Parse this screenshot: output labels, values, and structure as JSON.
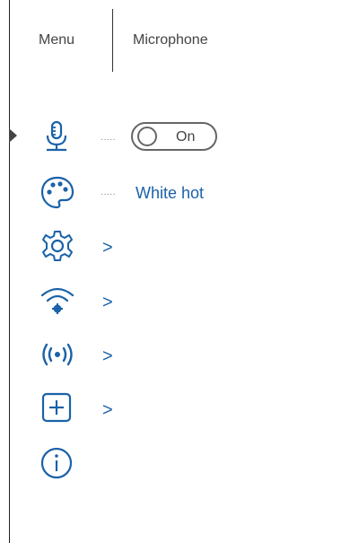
{
  "header": {
    "menu_label": "Menu",
    "title": "Microphone"
  },
  "menu": {
    "items": [
      {
        "icon": "microphone-icon",
        "trail": "dots",
        "control": "toggle",
        "toggle_label": "On",
        "toggle_state": "on"
      },
      {
        "icon": "palette-icon",
        "trail": "dots",
        "value": "White hot"
      },
      {
        "icon": "settings-gear-icon",
        "trail": ">"
      },
      {
        "icon": "wifi-settings-icon",
        "trail": ">"
      },
      {
        "icon": "broadcast-icon",
        "trail": ">"
      },
      {
        "icon": "add-box-icon",
        "trail": ">"
      },
      {
        "icon": "info-icon"
      }
    ],
    "dots_text": "·····",
    "chevron_text": ">"
  },
  "colors": {
    "accent": "#1a62a8",
    "text": "#444444",
    "border": "#666666"
  }
}
